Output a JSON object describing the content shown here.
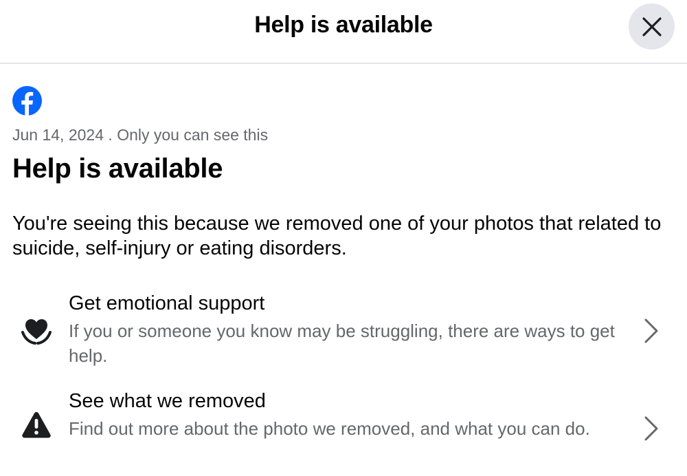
{
  "header": {
    "title": "Help is available",
    "close_icon": "close-icon"
  },
  "notice": {
    "logo_icon": "facebook-logo-icon",
    "date": "Jun 14, 2024",
    "separator": " . ",
    "visibility": "Only you can see this",
    "title": "Help is available",
    "body": "You're seeing this because we removed one of your photos that related to suicide, self-injury or eating disorders."
  },
  "options": [
    {
      "icon": "heart-hands-icon",
      "title": "Get emotional support",
      "description": "If you or someone you know may be struggling, there are ways to get help.",
      "chevron_icon": "chevron-right-icon"
    },
    {
      "icon": "warning-triangle-icon",
      "title": "See what we removed",
      "description": "Find out more about the photo we removed, and what you can do.",
      "chevron_icon": "chevron-right-icon"
    }
  ],
  "colors": {
    "facebook_blue": "#0866ff",
    "secondary_text": "#65676b",
    "primary_text": "#050505",
    "close_button_bg": "#e4e6eb"
  }
}
